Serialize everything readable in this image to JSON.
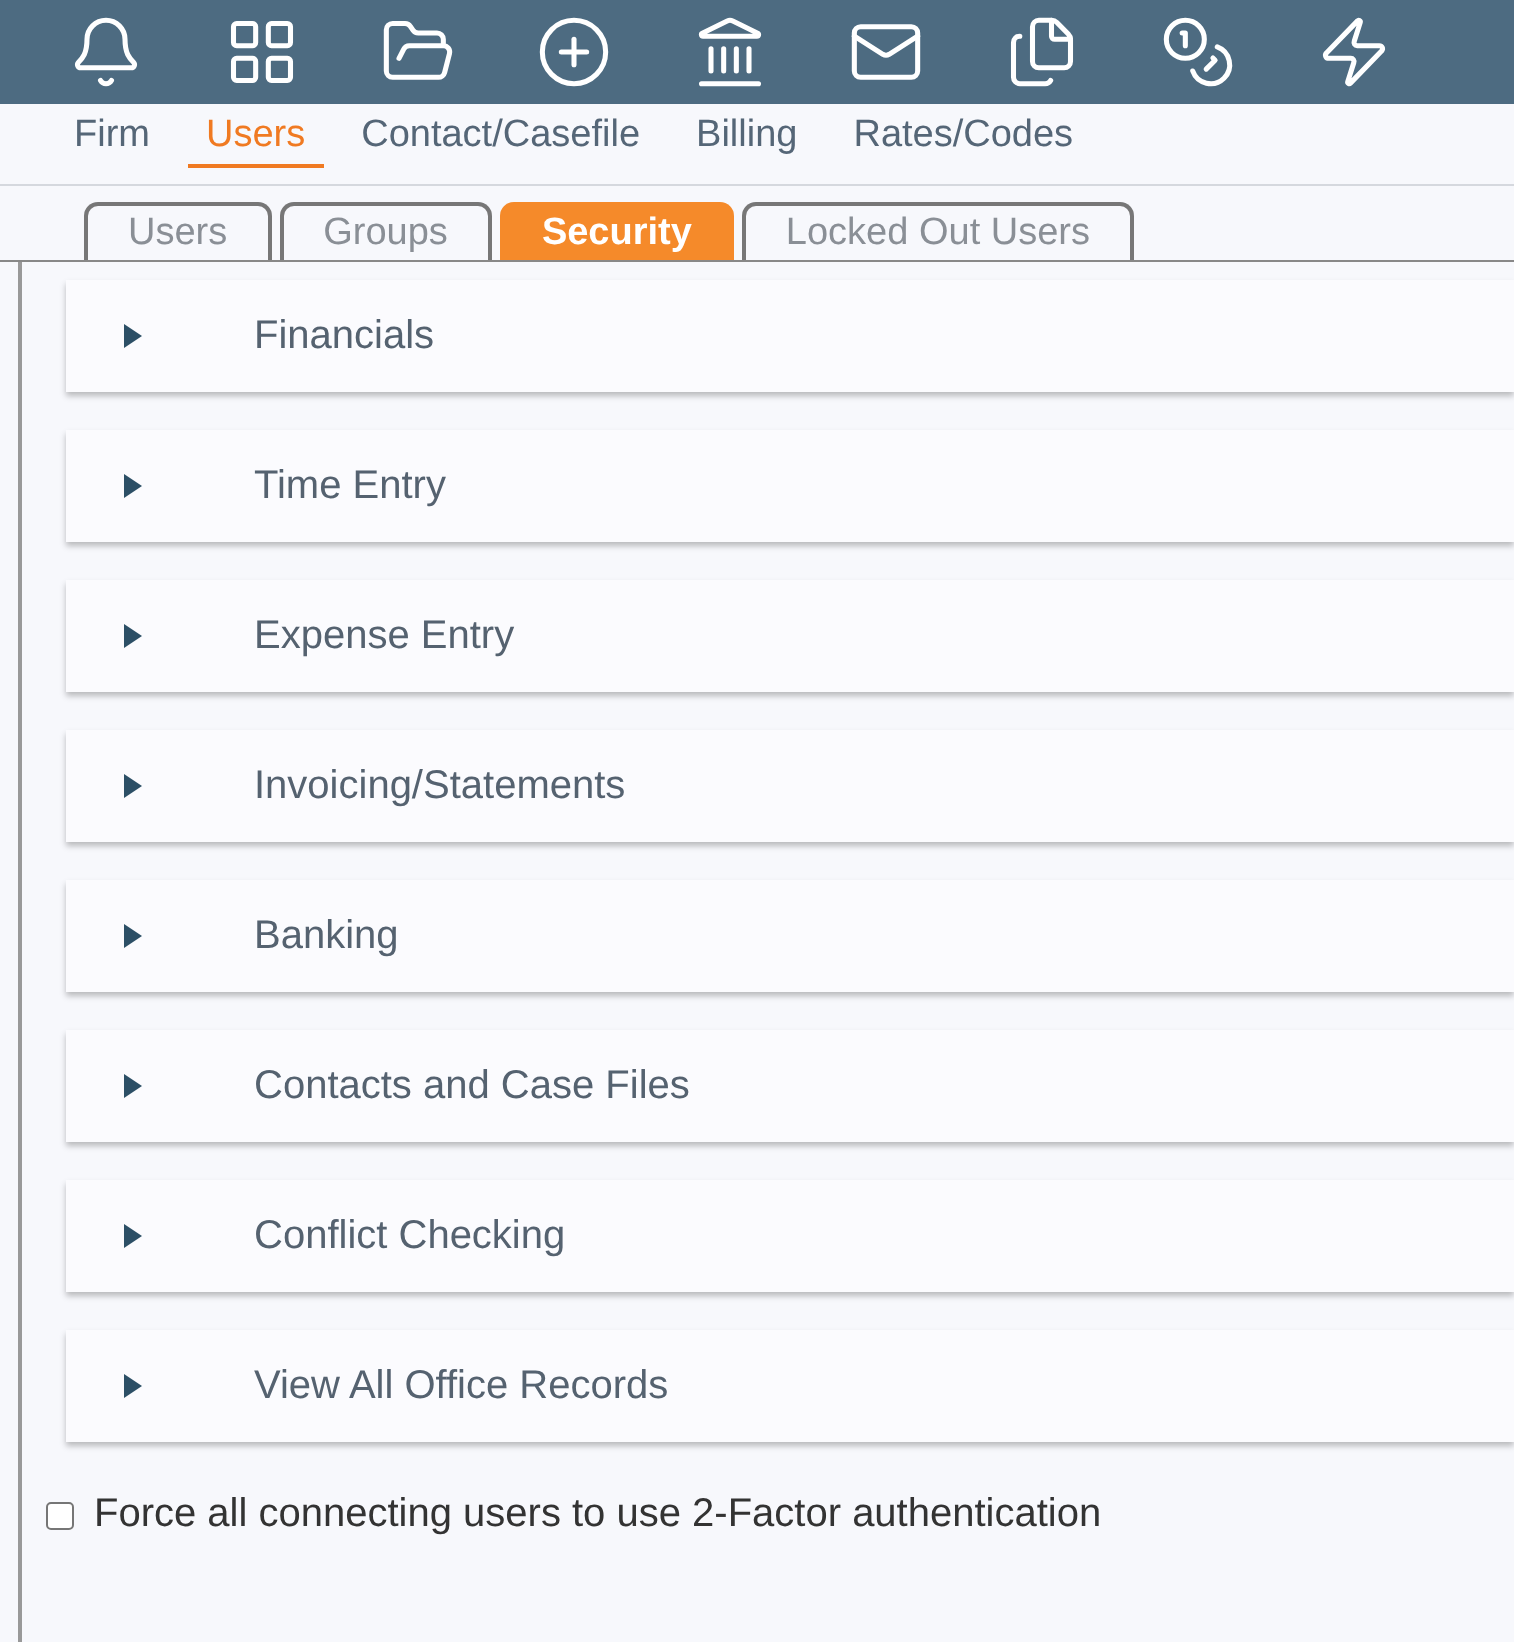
{
  "toolbar": {
    "icons": [
      {
        "kind": "bell"
      },
      {
        "kind": "grid"
      },
      {
        "kind": "folder"
      },
      {
        "kind": "plus"
      },
      {
        "kind": "bank"
      },
      {
        "kind": "mail"
      },
      {
        "kind": "files"
      },
      {
        "kind": "coins"
      },
      {
        "kind": "bolt"
      }
    ]
  },
  "nav": [
    {
      "label": "Firm",
      "selected": false
    },
    {
      "label": "Users",
      "selected": true
    },
    {
      "label": "Contact/Casefile",
      "selected": false
    },
    {
      "label": "Billing",
      "selected": false
    },
    {
      "label": "Rates/Codes",
      "selected": false
    }
  ],
  "subtabs": [
    {
      "label": "Users",
      "selected": false
    },
    {
      "label": "Groups",
      "selected": false
    },
    {
      "label": "Security",
      "selected": true
    },
    {
      "label": "Locked Out Users",
      "selected": false
    }
  ],
  "sections": [
    {
      "title": "Financials",
      "expanded": false
    },
    {
      "title": "Time Entry",
      "expanded": false
    },
    {
      "title": "Expense Entry",
      "expanded": false
    },
    {
      "title": "Invoicing/Statements",
      "expanded": false
    },
    {
      "title": "Banking",
      "expanded": false
    },
    {
      "title": "Contacts and Case Files",
      "expanded": false
    },
    {
      "title": "Conflict Checking",
      "expanded": false
    },
    {
      "title": "View All Office Records",
      "expanded": false
    }
  ],
  "two_factor": {
    "label": "Force all connecting users to use 2-Factor authentication",
    "checked": false
  }
}
